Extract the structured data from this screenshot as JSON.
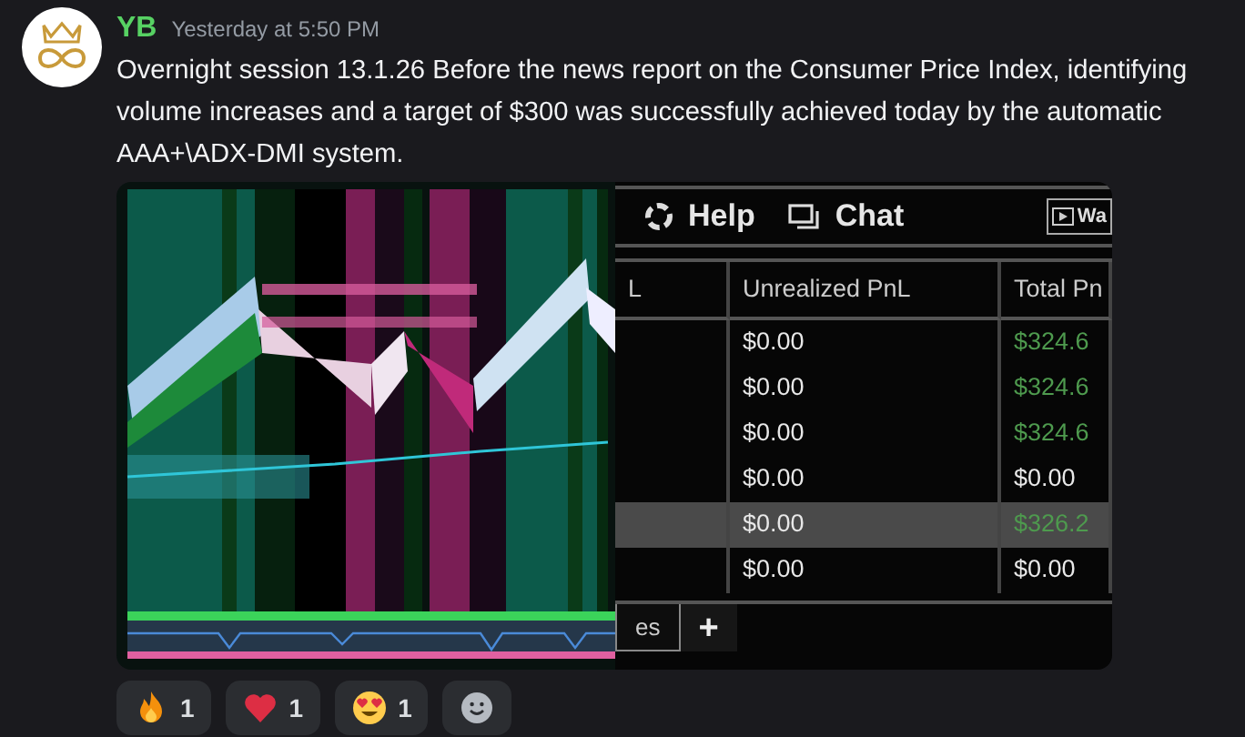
{
  "message": {
    "author": "YB",
    "timestamp": "Yesterday at 5:50 PM",
    "text": "Overnight session 13.1.26 Before the news report on the Consumer Price Index, identifying volume increases and a target of $300 was successfully achieved today by the automatic AAA+\\ADX-DMI system."
  },
  "attachments": [
    {
      "kind": "picture"
    },
    {
      "kind": "screenshot",
      "toolbar": [
        "Help",
        "Chat"
      ],
      "toolbar_button": "Wa",
      "columns": [
        "L",
        "Unrealized PnL",
        "Total Pn"
      ],
      "rows": [
        {
          "unrealized": "$0.00",
          "total": "$324.6",
          "color": "#4e9a4e",
          "selected": false
        },
        {
          "unrealized": "$0.00",
          "total": "$324.6",
          "color": "#4e9a4e",
          "selected": false
        },
        {
          "unrealized": "$0.00",
          "total": "$324.6",
          "color": "#4e9a4e",
          "selected": false
        },
        {
          "unrealized": "$0.00",
          "total": "$0.00",
          "color": "#e8e8e8",
          "selected": false
        },
        {
          "unrealized": "$0.00",
          "total": "$326.2",
          "color": "#4e9a4e",
          "selected": true
        },
        {
          "unrealized": "$0.00",
          "total": "$0.00",
          "color": "#e8e8e8",
          "selected": false
        }
      ],
      "tabs": [
        "es",
        "+"
      ]
    }
  ],
  "reactions": [
    {
      "kind": "fire",
      "count": "1"
    },
    {
      "kind": "heart",
      "count": "1"
    },
    {
      "kind": "heart-eyes",
      "count": "1"
    },
    {
      "kind": "add"
    }
  ]
}
